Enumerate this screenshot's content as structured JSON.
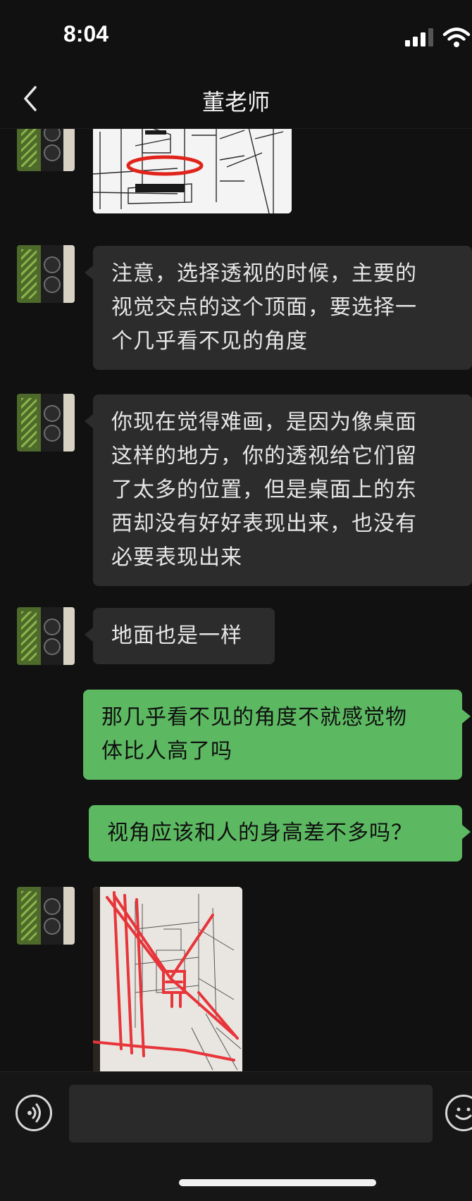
{
  "status_bar": {
    "time": "8:04",
    "icons": [
      "signal-icon",
      "wifi-icon"
    ]
  },
  "header": {
    "title": "董老师",
    "back_icon": "chevron-left-icon"
  },
  "messages": [
    {
      "from": "teacher",
      "type": "image",
      "description": "sketch-with-red-circle"
    },
    {
      "from": "teacher",
      "type": "text",
      "lines": [
        "注意，选择透视的时候，主要的",
        "视觉交点的这个顶面，要选择一",
        "个几乎看不见的角度"
      ]
    },
    {
      "from": "teacher",
      "type": "text",
      "lines": [
        "你现在觉得难画，是因为像桌面",
        "这样的地方，你的透视给它们留",
        "了太多的位置，但是桌面上的东",
        "西却没有好好表现出来，也没有",
        "必要表现出来"
      ]
    },
    {
      "from": "teacher",
      "type": "text",
      "lines": [
        "地面也是一样"
      ]
    },
    {
      "from": "me",
      "type": "text",
      "lines": [
        "那几乎看不见的角度不就感觉物",
        "体比人高了吗"
      ]
    },
    {
      "from": "me",
      "type": "text",
      "lines": [
        "视角应该和人的身高差不多吗？"
      ]
    },
    {
      "from": "teacher",
      "type": "image",
      "description": "sketch-with-red-perspective-lines"
    }
  ],
  "input_bar": {
    "placeholder": "",
    "voice_icon": "voice-icon",
    "emoji_icon": "emoji-icon"
  },
  "colors": {
    "background": "#111111",
    "incoming_bubble": "#2c2c2c",
    "outgoing_bubble": "#5cb961"
  }
}
